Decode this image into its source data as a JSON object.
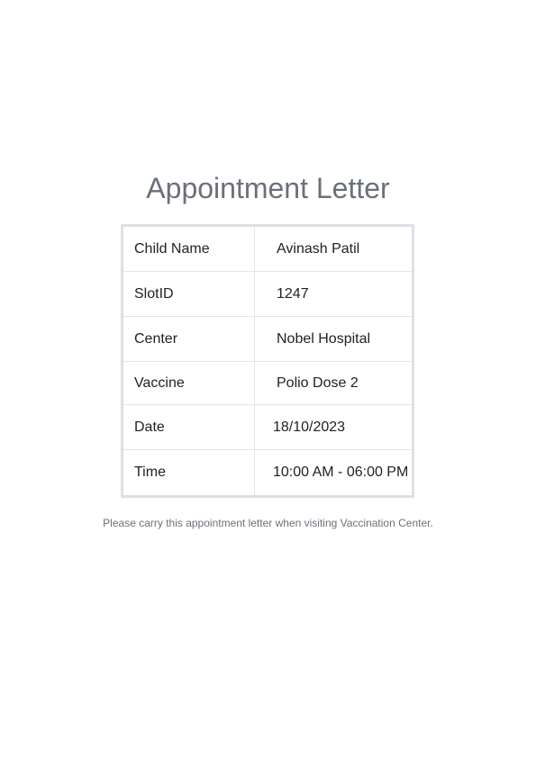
{
  "title": "Appointment Letter",
  "rows": [
    {
      "label": "Child Name",
      "value": "Avinash Patil"
    },
    {
      "label": "SlotID",
      "value": "1247"
    },
    {
      "label": "Center",
      "value": "Nobel Hospital"
    },
    {
      "label": "Vaccine",
      "value": "Polio Dose 2"
    },
    {
      "label": "Date",
      "value": "18/10/2023"
    },
    {
      "label": "Time",
      "value": "10:00 AM - 06:00 PM"
    }
  ],
  "note": "Please carry this appointment letter when visiting Vaccination Center."
}
